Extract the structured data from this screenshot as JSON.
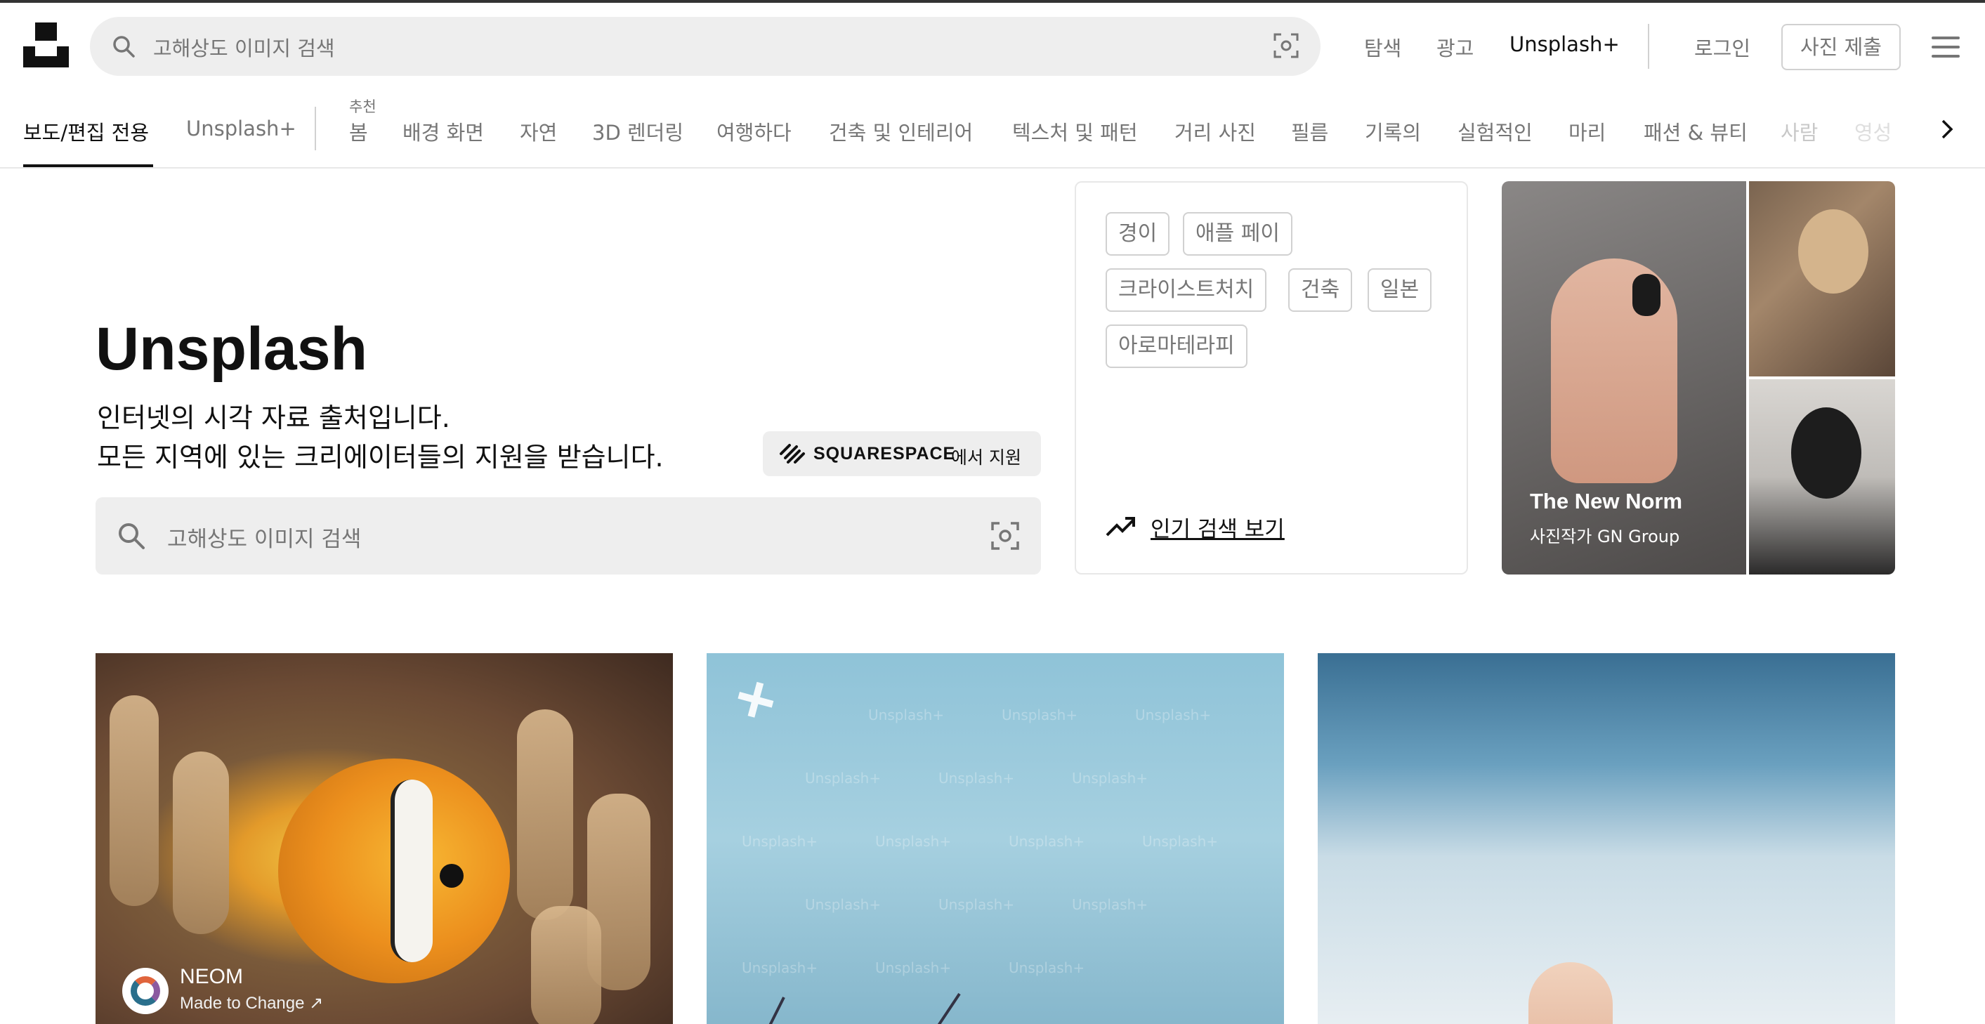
{
  "header": {
    "search_placeholder": "고해상도 이미지 검색",
    "nav": {
      "explore": "탐색",
      "advertise": "광고",
      "unsplash_plus": "Unsplash+",
      "login": "로그인",
      "submit": "사진 제출"
    }
  },
  "tabs": {
    "items": [
      {
        "label": "보도/편집 전용",
        "active": true
      },
      {
        "label": "Unsplash+"
      },
      {
        "label": "봄"
      },
      {
        "label": "배경 화면"
      },
      {
        "label": "자연"
      },
      {
        "label": "3D 렌더링"
      },
      {
        "label": "여행하다"
      },
      {
        "label": "건축 및 인테리어"
      },
      {
        "label": "텍스처 및 패턴"
      },
      {
        "label": "거리 사진"
      },
      {
        "label": "필름"
      },
      {
        "label": "기록의"
      },
      {
        "label": "실험적인"
      },
      {
        "label": "마리"
      },
      {
        "label": "패션 & 뷰티"
      },
      {
        "label": "사람"
      },
      {
        "label": "영성"
      }
    ],
    "recommended_badge": "추천"
  },
  "hero": {
    "title": "Unsplash",
    "line1": "인터넷의 시각 자료 출처입니다.",
    "line2": "모든 지역에 있는 크리에이터들의 지원을 받습니다.",
    "sponsor_brand": "SQUARESPACE",
    "sponsor_suffix": "에서 지원",
    "search_placeholder": "고해상도 이미지 검색"
  },
  "trending": {
    "chips": [
      "경이",
      "애플 페이",
      "크라이스트처치",
      "건축",
      "일본",
      "아로마테라피"
    ],
    "link": "인기 검색 보기"
  },
  "promo": {
    "title": "The New Norm",
    "subtitle": "사진작가 GN Group"
  },
  "photos": [
    {
      "author": "NEOM",
      "sub": "Made to Change ↗"
    },
    {
      "watermark": "Unsplash+"
    },
    {}
  ],
  "colors": {
    "text": "#111111",
    "muted": "#767676",
    "search_bg": "#eeeeee",
    "border": "#d1d1d1"
  }
}
